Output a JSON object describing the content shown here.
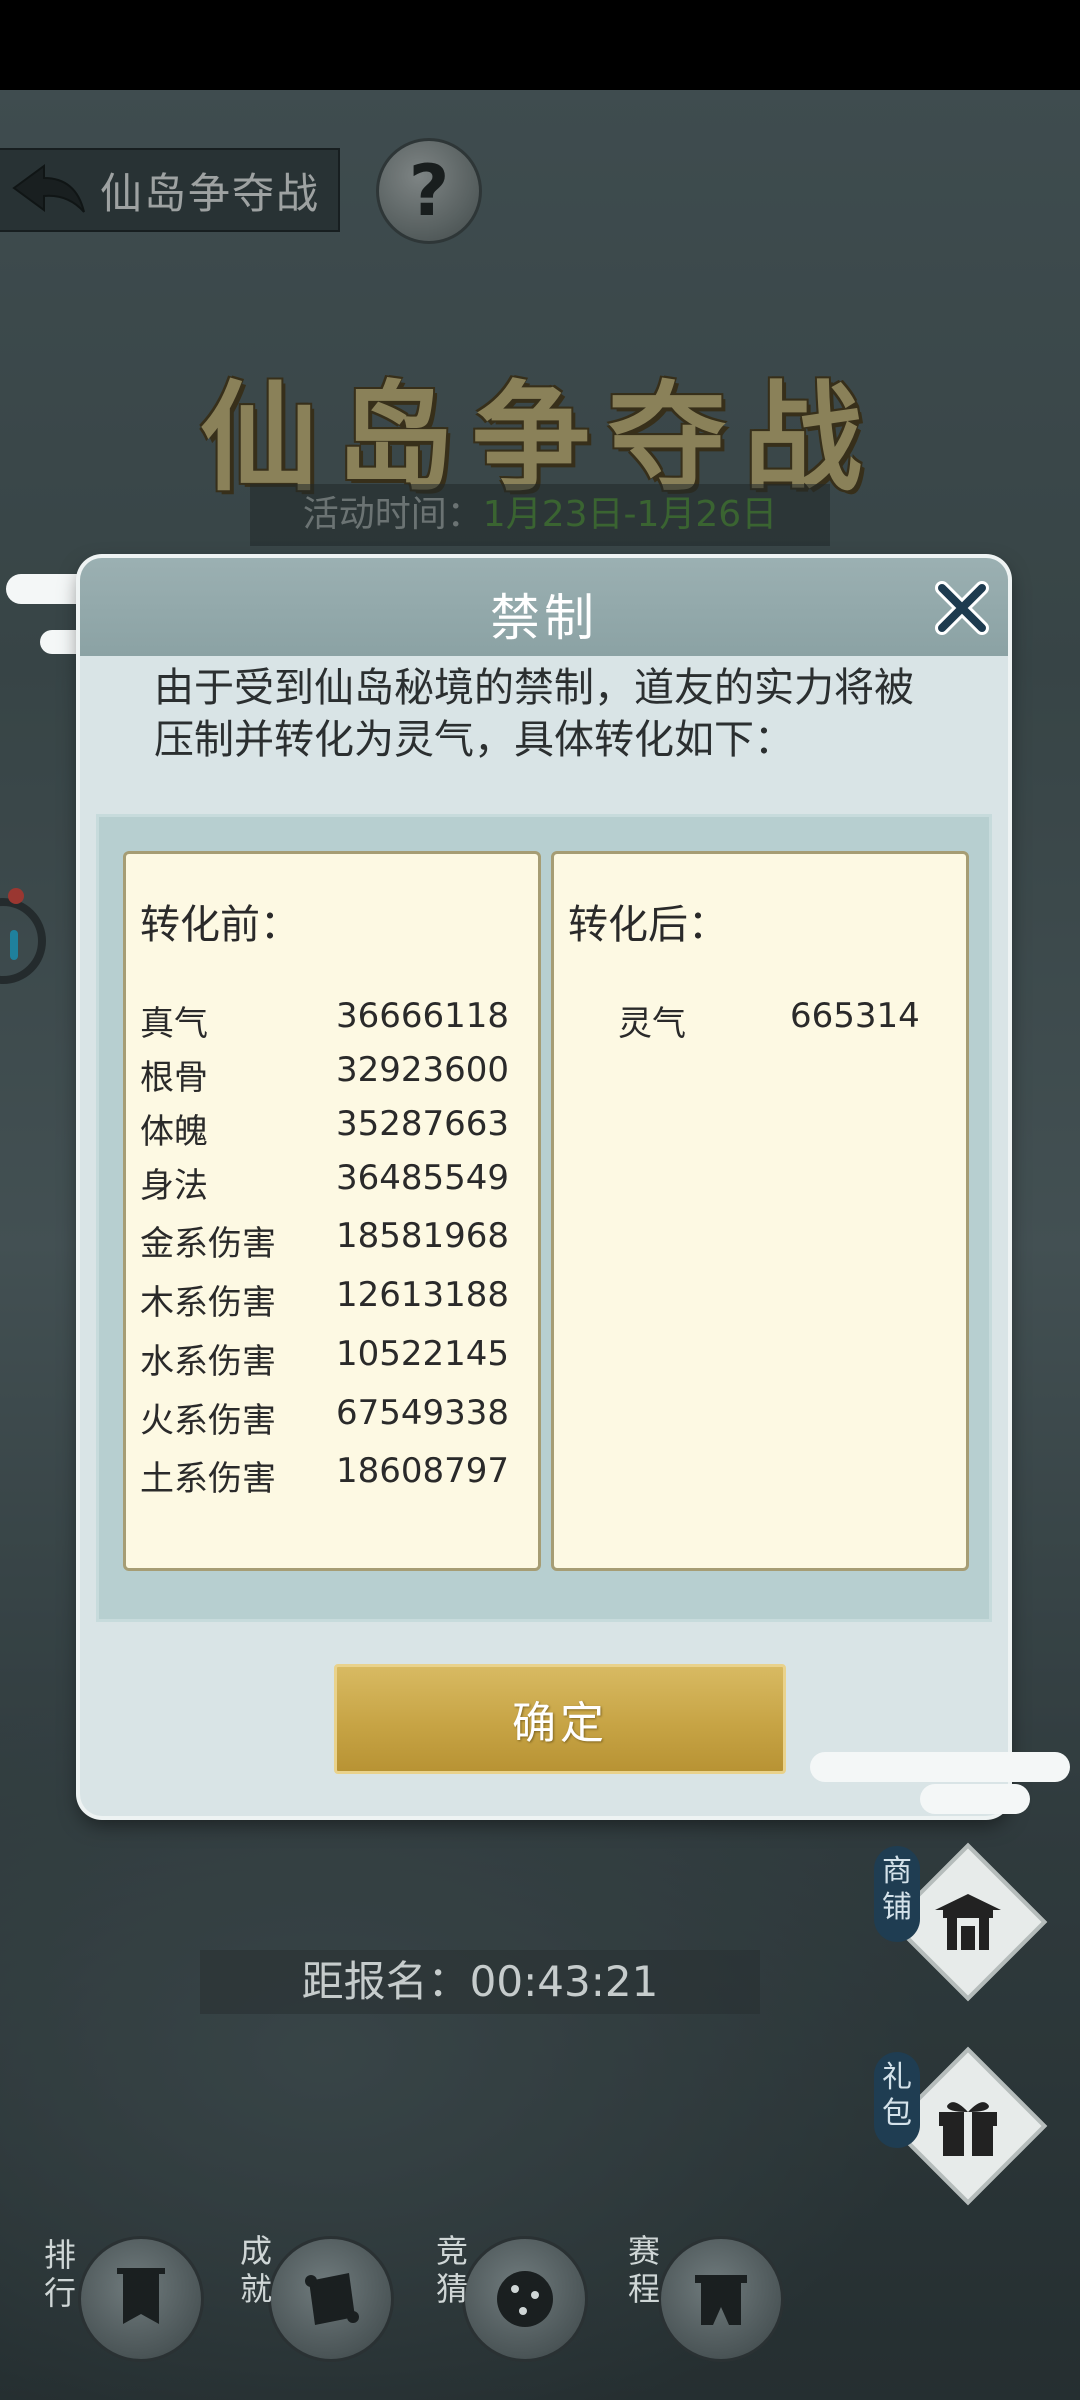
{
  "header": {
    "back_title": "仙岛争夺战",
    "help_label": "?",
    "big_title": "仙岛争夺战",
    "activity_label": "活动时间：",
    "activity_value": "1月23日-1月26日"
  },
  "dialog": {
    "title": "禁制",
    "intro": "由于受到仙岛秘境的禁制，道友的实力将被压制并转化为灵气，具体转化如下：",
    "before_heading": "转化前：",
    "after_heading": "转化后：",
    "before_rows": [
      {
        "label": "真气",
        "value": "36666118"
      },
      {
        "label": "根骨",
        "value": "32923600"
      },
      {
        "label": "体魄",
        "value": "35287663"
      },
      {
        "label": "身法",
        "value": "36485549"
      },
      {
        "label": "金系伤害",
        "value": "18581968"
      },
      {
        "label": "木系伤害",
        "value": "12613188"
      },
      {
        "label": "水系伤害",
        "value": "10522145"
      },
      {
        "label": "火系伤害",
        "value": "67549338"
      },
      {
        "label": "土系伤害",
        "value": "18608797"
      }
    ],
    "after_rows": [
      {
        "label": "灵气",
        "value": "665314"
      }
    ],
    "confirm_label": "确定"
  },
  "footer": {
    "register_countdown": "距报名：00:43:21",
    "shop_label": "商铺",
    "gift_label": "礼包",
    "rank_label": "排行",
    "achievement_label": "成就",
    "guess_label": "竞猜",
    "schedule_label": "赛程"
  },
  "colors": {
    "accent_gold": "#c7a445",
    "activity_green": "#4f8a3c",
    "dialog_header": "#8ba2a4",
    "panel_bg": "#fdf9e3"
  }
}
